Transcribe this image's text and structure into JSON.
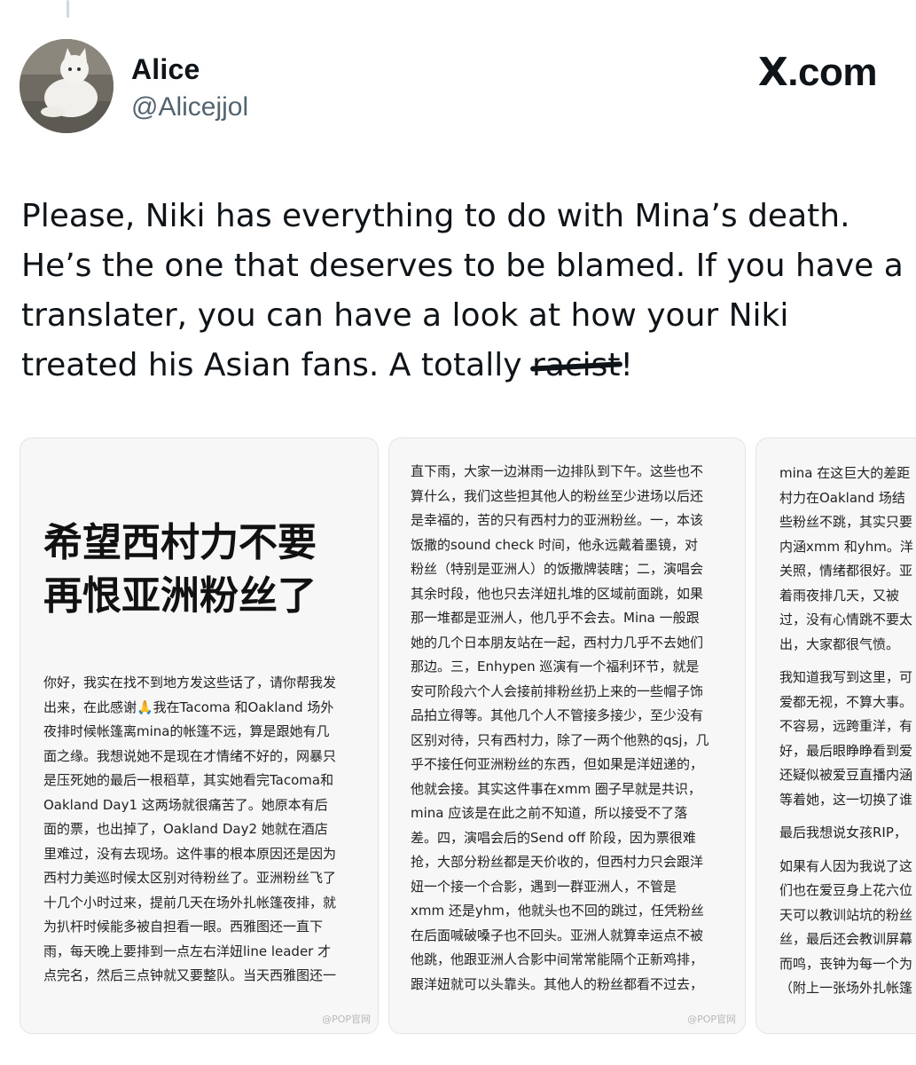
{
  "author": {
    "display_name": "Alice",
    "handle": "@Alicejjol",
    "avatar": "white-cat-avatar"
  },
  "brand": {
    "logo": "X",
    "suffix": ".com"
  },
  "tweet": {
    "lines": [
      "Please, Niki has everything to do with Mina’s death.",
      "He’s the one that deserves to be blamed. If you have a",
      "translater, you can have a look at how your Niki"
    ],
    "last_line_prefix": "treated his Asian fans. A totally ",
    "struck_word": "racist",
    "last_line_suffix": "!"
  },
  "media": {
    "card1": {
      "headline_line1": "希望西村力不要",
      "headline_line2": "再恨亚洲粉丝了",
      "lines": [
        "你好，我实在找不到地方发这些话了，请你帮我发",
        "出来，在此感谢🙏我在Tacoma 和Oakland 场外",
        "夜排时候帐篷离mina的帐篷不远，算是跟她有几",
        "面之缘。我想说她不是现在才情绪不好的，网暴只",
        "是压死她的最后一根稻草，其实她看完Tacoma和",
        "Oakland Day1 这两场就很痛苦了。她原本有后",
        "面的票，也出掉了，Oakland Day2 她就在酒店",
        "里难过，没有去现场。这件事的根本原因还是因为",
        "西村力美巡时候太区别对待粉丝了。亚洲粉丝飞了",
        "十几个小时过来，提前几天在场外扎帐篷夜排，就",
        "为扒杆时候能多被自担看一眼。西雅图还一直下",
        "雨，每天晚上要排到一点左右洋妞line leader 才",
        "点完名，然后三点钟就又要整队。当天西雅图还一"
      ],
      "watermark": "@POP官网"
    },
    "card2": {
      "lines": [
        "直下雨，大家一边淋雨一边排队到下午。这些也不",
        "算什么，我们这些担其他人的粉丝至少进场以后还",
        "是幸福的，苦的只有西村力的亚洲粉丝。一，本该",
        "饭撒的sound check 时间，他永远戴着墨镜，对",
        "粉丝（特别是亚洲人）的饭撒牌装瞎；二，演唱会",
        "其余时段，他也只去洋妞扎堆的区域前面跳，如果",
        "那一堆都是亚洲人，他几乎不会去。Mina 一般跟",
        "她的几个日本朋友站在一起，西村力几乎不去她们",
        "那边。三，Enhypen 巡演有一个福利环节，就是",
        "安可阶段六个人会接前排粉丝扔上来的一些帽子饰",
        "品拍立得等。其他几个人不管接多接少，至少没有",
        "区别对待，只有西村力，除了一两个他熟的qsj，几",
        "乎不接任何亚洲粉丝的东西，但如果是洋妞递的，",
        "他就会接。其实这件事在xmm 圈子早就是共识，",
        "mina 应该是在此之前不知道，所以接受不了落",
        "差。四，演唱会后的Send off 阶段，因为票很难",
        "抢，大部分粉丝都是天价收的，但西村力只会跟洋",
        "妞一个接一个合影，遇到一群亚洲人，不管是",
        "xmm 还是yhm，他就头也不回的跳过，任凭粉丝",
        "在后面喊破嗓子也不回头。亚洲人就算幸运点不被",
        "他跳，他跟亚洲人合影中间常常能隔个正新鸡排，",
        "跟洋妞就可以头靠头。其他人的粉丝都看不过去，"
      ],
      "watermark": "@POP官网"
    },
    "card3": {
      "para1": [
        "mina 在这巨大的差距",
        "村力在Oakland 场结",
        "些粉丝不跳，其实只要",
        "内涵xmm 和yhm。洋",
        "关照，情绪都很好。亚",
        "着雨夜排几天，又被",
        "过，没有心情跳不要太",
        "出，大家都很气愤。"
      ],
      "para2": [
        "我知道我写到这里，可",
        "爱都无视，不算大事。",
        "不容易，远跨重洋，有",
        "好，最后眼睁睁看到爱",
        "还疑似被爱豆直播内涵",
        "等着她，这一切换了谁"
      ],
      "para3": [
        "最后我想说女孩RIP，"
      ],
      "para4": [
        "如果有人因为我说了这",
        "们也在爱豆身上花六位",
        "天可以教训站坑的粉丝",
        "丝，最后还会教训屏幕",
        "而鸣，丧钟为每一个为",
        "（附上一张场外扎帐篷"
      ]
    }
  }
}
